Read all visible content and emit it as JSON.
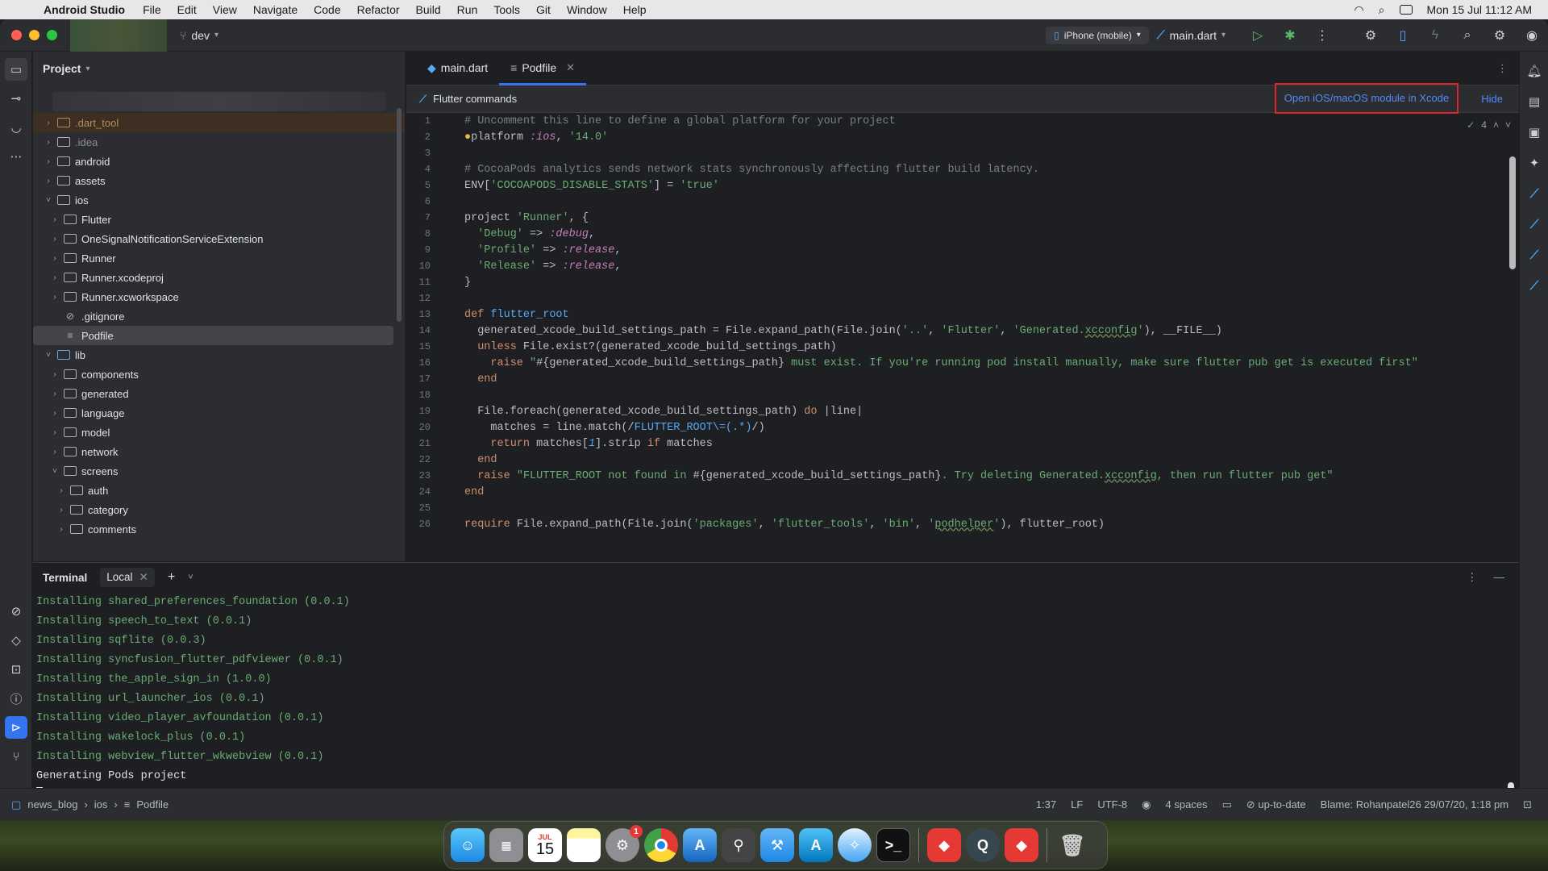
{
  "menubar": {
    "app_name": "Android Studio",
    "menus": [
      "File",
      "Edit",
      "View",
      "Navigate",
      "Code",
      "Refactor",
      "Build",
      "Run",
      "Tools",
      "Git",
      "Window",
      "Help"
    ],
    "clock": "Mon 15 Jul  11:12 AM"
  },
  "titlebar": {
    "branch": "dev",
    "device": "iPhone (mobile)",
    "run_config": "main.dart"
  },
  "project": {
    "header": "Project",
    "tree": [
      {
        "label": ".dart_tool",
        "type": "folder",
        "depth": 0,
        "expanded": false,
        "state": "excluded"
      },
      {
        "label": ".idea",
        "type": "folder",
        "depth": 0,
        "expanded": false,
        "state": "dim"
      },
      {
        "label": "android",
        "type": "folder",
        "depth": 0,
        "expanded": false
      },
      {
        "label": "assets",
        "type": "folder",
        "depth": 0,
        "expanded": false
      },
      {
        "label": "ios",
        "type": "folder",
        "depth": 0,
        "expanded": true
      },
      {
        "label": "Flutter",
        "type": "folder",
        "depth": 1,
        "expanded": false
      },
      {
        "label": "OneSignalNotificationServiceExtension",
        "type": "folder",
        "depth": 1,
        "expanded": false
      },
      {
        "label": "Runner",
        "type": "folder",
        "depth": 1,
        "expanded": false
      },
      {
        "label": "Runner.xcodeproj",
        "type": "folder",
        "depth": 1,
        "expanded": false
      },
      {
        "label": "Runner.xcworkspace",
        "type": "folder",
        "depth": 1,
        "expanded": false
      },
      {
        "label": ".gitignore",
        "type": "file",
        "depth": 1
      },
      {
        "label": "Podfile",
        "type": "file",
        "depth": 1,
        "state": "selected"
      },
      {
        "label": "lib",
        "type": "folder",
        "depth": 0,
        "expanded": true,
        "state": "lib"
      },
      {
        "label": "components",
        "type": "folder",
        "depth": 1,
        "expanded": false
      },
      {
        "label": "generated",
        "type": "folder",
        "depth": 1,
        "expanded": false
      },
      {
        "label": "language",
        "type": "folder",
        "depth": 1,
        "expanded": false
      },
      {
        "label": "model",
        "type": "folder",
        "depth": 1,
        "expanded": false
      },
      {
        "label": "network",
        "type": "folder",
        "depth": 1,
        "expanded": false
      },
      {
        "label": "screens",
        "type": "folder",
        "depth": 1,
        "expanded": true
      },
      {
        "label": "auth",
        "type": "folder",
        "depth": 2,
        "expanded": false
      },
      {
        "label": "category",
        "type": "folder",
        "depth": 2,
        "expanded": false
      },
      {
        "label": "comments",
        "type": "folder",
        "depth": 2,
        "expanded": false
      }
    ]
  },
  "editor": {
    "tabs": [
      {
        "label": "main.dart",
        "active": false
      },
      {
        "label": "Podfile",
        "active": true
      }
    ],
    "banner": {
      "title": "Flutter commands",
      "open_xcode": "Open iOS/macOS module in Xcode",
      "hide": "Hide"
    },
    "inspection_count": "4"
  },
  "terminal": {
    "title": "Terminal",
    "tab": "Local",
    "lines": [
      "Installing shared_preferences_foundation (0.0.1)",
      "Installing speech_to_text (0.0.1)",
      "Installing sqflite (0.0.3)",
      "Installing syncfusion_flutter_pdfviewer (0.0.1)",
      "Installing the_apple_sign_in (1.0.0)",
      "Installing url_launcher_ios (0.0.1)",
      "Installing video_player_avfoundation (0.0.1)",
      "Installing wakelock_plus (0.0.1)",
      "Installing webview_flutter_wkwebview (0.0.1)"
    ],
    "last_line": "Generating Pods project"
  },
  "status": {
    "breadcrumb": [
      "news_blog",
      "ios",
      "Podfile"
    ],
    "position": "1:37",
    "line_sep": "LF",
    "encoding": "UTF-8",
    "indent": "4 spaces",
    "vcs": "up-to-date",
    "blame": "Blame: Rohanpatel26 29/07/20, 1:18 pm"
  },
  "dock": {
    "calendar_month": "JUL",
    "calendar_day": "15",
    "settings_badge": "1"
  }
}
